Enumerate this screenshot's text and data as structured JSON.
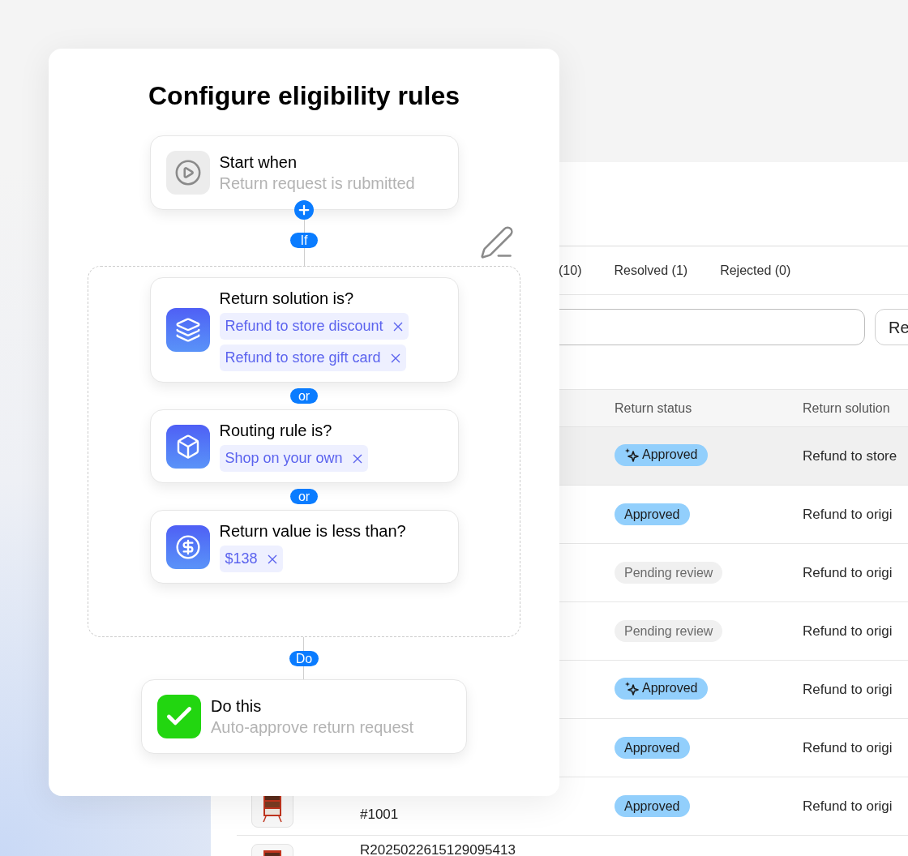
{
  "flow": {
    "title": "Configure eligibility rules",
    "trigger": {
      "title": "Start when",
      "subtitle": "Return request is rubmitted"
    },
    "if_label": "If",
    "conditions": [
      {
        "kind": "layers",
        "title": "Return solution is?",
        "chips": [
          "Refund to store discount",
          "Refund to store gift card"
        ]
      },
      {
        "kind": "box",
        "title": "Routing rule is?",
        "chips": [
          "Shop on your own"
        ]
      },
      {
        "kind": "dollar",
        "title": "Return value is less than?",
        "chips": [
          "$138"
        ]
      }
    ],
    "joiners": [
      "or",
      "or"
    ],
    "do_label": "Do",
    "action": {
      "title": "Do this",
      "subtitle": "Auto-approve return request"
    }
  },
  "returns": {
    "tabs": [
      {
        "label": "(10)",
        "selected": false
      },
      {
        "label": "Resolved (1)",
        "selected": false
      },
      {
        "label": "Rejected (0)",
        "selected": false
      }
    ],
    "filter_button": "Re",
    "columns": [
      "Return status",
      "Return solution"
    ],
    "rows": [
      {
        "highlighted": true,
        "status": {
          "label": "Approved",
          "kind": "approved",
          "auto": true
        },
        "solution": "Refund to store"
      },
      {
        "highlighted": false,
        "status": {
          "label": "Approved",
          "kind": "approved",
          "auto": false
        },
        "solution": "Refund to origi"
      },
      {
        "highlighted": false,
        "status": {
          "label": "Pending review",
          "kind": "pending",
          "auto": false
        },
        "solution": "Refund to origi"
      },
      {
        "highlighted": false,
        "status": {
          "label": "Pending review",
          "kind": "pending",
          "auto": false
        },
        "solution": "Refund to origi"
      },
      {
        "highlighted": false,
        "status": {
          "label": "Approved",
          "kind": "approved",
          "auto": true
        },
        "solution": "Refund to origi"
      },
      {
        "highlighted": false,
        "status": {
          "label": "Approved",
          "kind": "approved",
          "auto": false
        },
        "solution": "Refund to origi"
      },
      {
        "highlighted": false,
        "product_image": true,
        "order_number": "#1001",
        "status": {
          "label": "Approved",
          "kind": "approved",
          "auto": false
        },
        "solution": "Refund to origi"
      },
      {
        "highlighted": false,
        "product_image": true,
        "order_id": "R2025022615129095413"
      }
    ]
  }
}
